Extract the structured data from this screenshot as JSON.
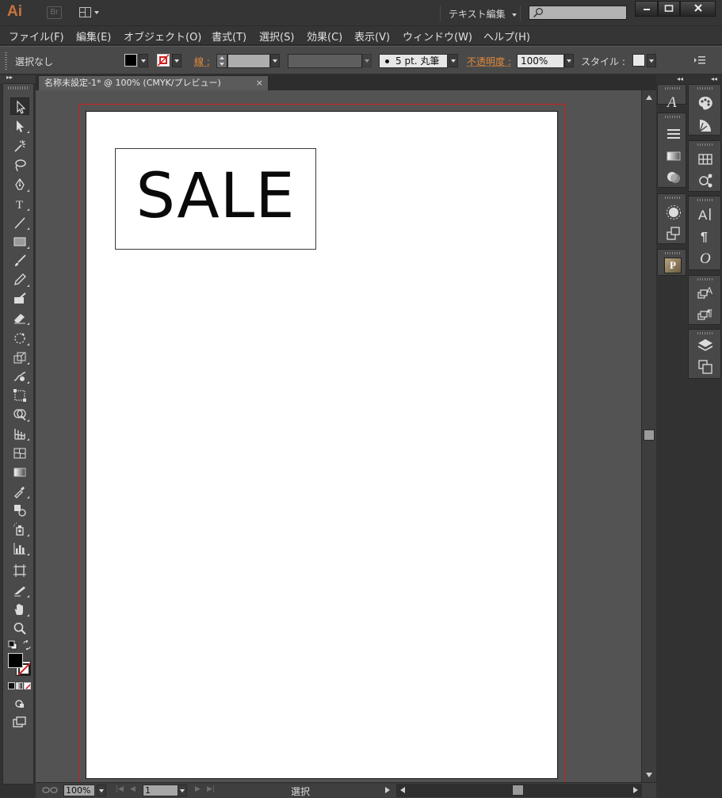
{
  "app": {
    "logo": "Ai",
    "bridge_logo": "Br",
    "workspace": "テキスト編集",
    "search_placeholder": ""
  },
  "menu": [
    "ファイル(F)",
    "編集(E)",
    "オブジェクト(O)",
    "書式(T)",
    "選択(S)",
    "効果(C)",
    "表示(V)",
    "ウィンドウ(W)",
    "ヘルプ(H)"
  ],
  "control_bar": {
    "selection_label": "選択なし",
    "stroke_label": "線 :",
    "brush_label": "5 pt. 丸筆",
    "opacity_label": "不透明度 :",
    "opacity_value": "100%",
    "style_label": "スタイル :"
  },
  "document": {
    "tab_title": "名称未設定-1* @ 100% (CMYK/プレビュー)",
    "tab_close": "×",
    "artwork_text": "SALE"
  },
  "status_bar": {
    "zoom": "100%",
    "page": "1",
    "status_text": "選択"
  },
  "colors": {
    "app_accent": "#c8733e",
    "label_orange": "#e18a3c",
    "bleed_line": "#d02020",
    "artboard": "#ffffff"
  },
  "icons": {
    "tools": [
      "selection-tool-icon",
      "direct-selection-tool-icon",
      "magic-wand-tool-icon",
      "lasso-tool-icon",
      "pen-tool-icon",
      "type-tool-icon",
      "line-segment-tool-icon",
      "rectangle-tool-icon",
      "paintbrush-tool-icon",
      "pencil-tool-icon",
      "blob-brush-tool-icon",
      "eraser-tool-icon",
      "rotate-tool-icon",
      "scale-tool-icon",
      "warp-tool-icon",
      "free-transform-tool-icon",
      "shape-builder-tool-icon",
      "perspective-grid-tool-icon",
      "mesh-tool-icon",
      "gradient-tool-icon",
      "eyedropper-tool-icon",
      "blend-tool-icon",
      "symbol-sprayer-tool-icon",
      "column-graph-tool-icon",
      "artboard-tool-icon",
      "slice-tool-icon",
      "hand-tool-icon",
      "zoom-tool-icon"
    ],
    "panels_col1": [
      "character-styles-icon",
      "stroke-panel-icon",
      "gradient-panel-icon",
      "transparency-panel-icon",
      "appearance-panel-icon",
      "graphic-styles-icon",
      "plugin-panel-icon"
    ],
    "panels_col2": [
      "color-panel-icon",
      "color-guide-icon",
      "swatches-panel-icon",
      "symbols-panel-icon",
      "character-panel-icon",
      "paragraph-panel-icon",
      "opentype-panel-icon",
      "character-styles-panel-icon",
      "paragraph-styles-panel-icon",
      "layers-panel-icon",
      "artboards-panel-icon"
    ]
  }
}
